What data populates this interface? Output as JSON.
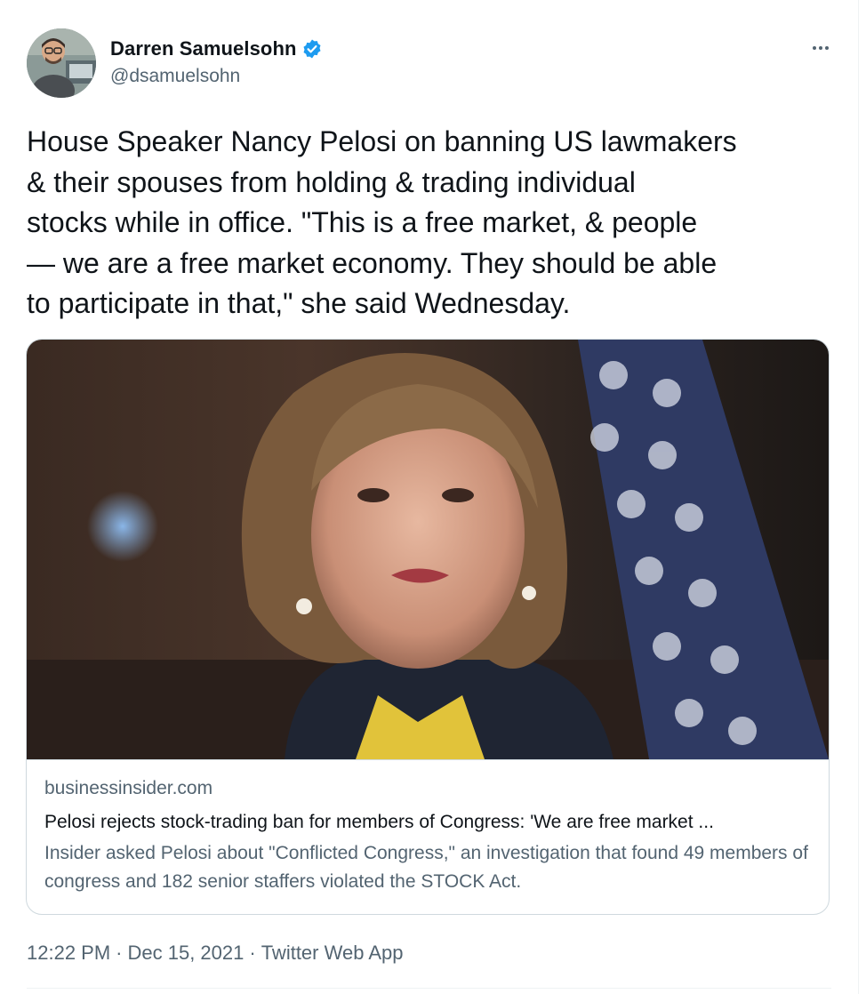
{
  "author": {
    "display_name": "Darren Samuelsohn",
    "handle": "@dsamuelsohn",
    "verified": true
  },
  "icons": {
    "verified": "verified-badge-icon",
    "more": "more-horizontal-icon"
  },
  "tweet": {
    "text": "House Speaker Nancy Pelosi on banning US lawmakers\n& their spouses from holding & trading individual\nstocks while in office. \"This is a free market, & people\n— we are a free market economy. They should be able\nto participate in that,\" she said Wednesday."
  },
  "card": {
    "domain": "businessinsider.com",
    "title": "Pelosi rejects stock-trading ban for members of Congress: 'We are free market ...",
    "description": "Insider asked Pelosi about \"Conflicted Congress,\" an investigation that found 49 members of congress and 182 senior staffers violated the STOCK Act."
  },
  "footer": {
    "time": "12:22 PM",
    "separator": "·",
    "date": "Dec 15, 2021",
    "source": "Twitter Web App"
  },
  "colors": {
    "text_primary": "#0f1419",
    "text_secondary": "#536471",
    "verified_blue": "#1d9bf0",
    "border": "#cfd9de"
  }
}
